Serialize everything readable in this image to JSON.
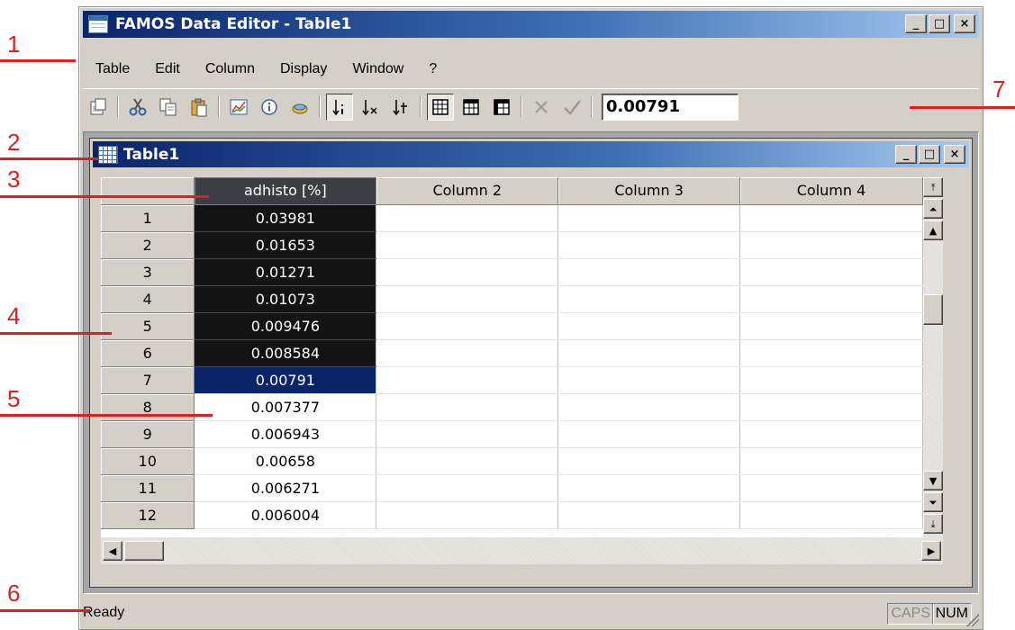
{
  "window": {
    "title": "FAMOS Data Editor - Table1"
  },
  "menu": {
    "items": [
      "Table",
      "Edit",
      "Column",
      "Display",
      "Window",
      "?"
    ]
  },
  "toolbar": {
    "value_field": "0.00791",
    "icons": [
      "copy-report-icon",
      "cut-icon",
      "copy-icon",
      "paste-icon",
      "chart-icon",
      "info-icon",
      "export-icon",
      "sort-ascending-icon",
      "sort-x-icon",
      "sort-t-icon",
      "grid-view-icon",
      "grid-alt-icon",
      "grid-details-icon",
      "cancel-icon",
      "confirm-icon"
    ]
  },
  "child_window": {
    "title": "Table1"
  },
  "table": {
    "columns": [
      "adhisto [%]",
      "Column 2",
      "Column 3",
      "Column 4"
    ],
    "rows": [
      {
        "num": "1",
        "value": "0.03981"
      },
      {
        "num": "2",
        "value": "0.01653"
      },
      {
        "num": "3",
        "value": "0.01271"
      },
      {
        "num": "4",
        "value": "0.01073"
      },
      {
        "num": "5",
        "value": "0.009476"
      },
      {
        "num": "6",
        "value": "0.008584"
      },
      {
        "num": "7",
        "value": "0.00791"
      },
      {
        "num": "8",
        "value": "0.007377"
      },
      {
        "num": "9",
        "value": "0.006943"
      },
      {
        "num": "10",
        "value": "0.00658"
      },
      {
        "num": "11",
        "value": "0.006271"
      },
      {
        "num": "12",
        "value": "0.006004"
      }
    ]
  },
  "status": {
    "text": "Ready",
    "caps": "CAPS",
    "num": "NUM"
  },
  "callouts": [
    "1",
    "2",
    "3",
    "4",
    "5",
    "6",
    "7"
  ],
  "colors": {
    "title_gradient_start": "#0a246a",
    "selection": "#131313",
    "current_cell": "#0a246a",
    "callout": "#e02020"
  }
}
